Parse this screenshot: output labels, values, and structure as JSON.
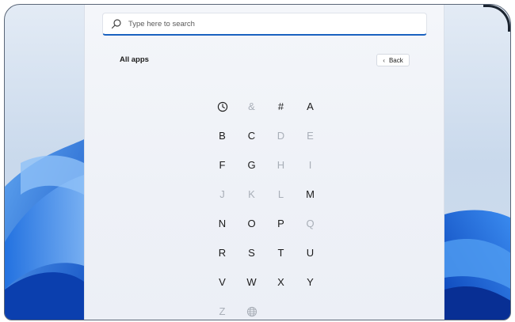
{
  "search": {
    "placeholder": "Type here to search",
    "icon": "search-icon"
  },
  "all_apps": {
    "heading": "All apps",
    "back": {
      "label": "Back",
      "icon": "chevron-left-icon"
    }
  },
  "colors": {
    "accent": "#1a62c0",
    "enabled_letter": "#1b1b1b",
    "disabled_letter": "#a9afb8",
    "panel": "#f1f3f8"
  },
  "letter_grid": [
    {
      "type": "icon",
      "icon": "clock-icon",
      "label": "Recently added",
      "enabled": true
    },
    {
      "type": "text",
      "label": "&",
      "enabled": false
    },
    {
      "type": "text",
      "label": "#",
      "enabled": true
    },
    {
      "type": "text",
      "label": "A",
      "enabled": true
    },
    {
      "type": "text",
      "label": "B",
      "enabled": true
    },
    {
      "type": "text",
      "label": "C",
      "enabled": true
    },
    {
      "type": "text",
      "label": "D",
      "enabled": false
    },
    {
      "type": "text",
      "label": "E",
      "enabled": false
    },
    {
      "type": "text",
      "label": "F",
      "enabled": true
    },
    {
      "type": "text",
      "label": "G",
      "enabled": true
    },
    {
      "type": "text",
      "label": "H",
      "enabled": false
    },
    {
      "type": "text",
      "label": "I",
      "enabled": false
    },
    {
      "type": "text",
      "label": "J",
      "enabled": false
    },
    {
      "type": "text",
      "label": "K",
      "enabled": false
    },
    {
      "type": "text",
      "label": "L",
      "enabled": false
    },
    {
      "type": "text",
      "label": "M",
      "enabled": true
    },
    {
      "type": "text",
      "label": "N",
      "enabled": true
    },
    {
      "type": "text",
      "label": "O",
      "enabled": true
    },
    {
      "type": "text",
      "label": "P",
      "enabled": true
    },
    {
      "type": "text",
      "label": "Q",
      "enabled": false
    },
    {
      "type": "text",
      "label": "R",
      "enabled": true
    },
    {
      "type": "text",
      "label": "S",
      "enabled": true
    },
    {
      "type": "text",
      "label": "T",
      "enabled": true
    },
    {
      "type": "text",
      "label": "U",
      "enabled": true
    },
    {
      "type": "text",
      "label": "V",
      "enabled": true
    },
    {
      "type": "text",
      "label": "W",
      "enabled": true
    },
    {
      "type": "text",
      "label": "X",
      "enabled": true
    },
    {
      "type": "text",
      "label": "Y",
      "enabled": true
    },
    {
      "type": "text",
      "label": "Z",
      "enabled": false
    },
    {
      "type": "icon",
      "icon": "globe-icon",
      "label": "Other languages",
      "enabled": false
    }
  ]
}
